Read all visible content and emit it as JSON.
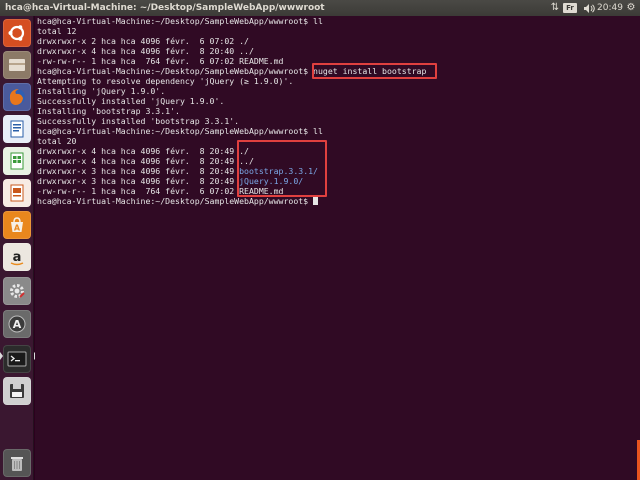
{
  "top_panel": {
    "window_title": "hca@hca-Virtual-Machine: ~/Desktop/SampleWebApp/wwwroot",
    "keyboard_layout": "Fr",
    "clock": "20:49"
  },
  "launcher": {
    "items": [
      {
        "id": "dash",
        "icon": "ubuntu-logo-icon",
        "bg": "#d54e21"
      },
      {
        "id": "files",
        "icon": "files-icon",
        "bg": "#8c7a67"
      },
      {
        "id": "firefox",
        "icon": "firefox-icon",
        "bg": "#4a5a9c"
      },
      {
        "id": "writer",
        "icon": "libreoffice-writer-icon",
        "bg": "#e8eef7"
      },
      {
        "id": "calc",
        "icon": "libreoffice-calc-icon",
        "bg": "#e8f2e3"
      },
      {
        "id": "impress",
        "icon": "libreoffice-impress-icon",
        "bg": "#f7ebe3"
      },
      {
        "id": "software-center",
        "icon": "software-center-icon",
        "bg": "#e9871d"
      },
      {
        "id": "amazon",
        "icon": "amazon-icon",
        "bg": "#ece7e0"
      },
      {
        "id": "settings",
        "icon": "system-settings-icon",
        "bg": "#8a8a8a"
      },
      {
        "id": "updater",
        "icon": "software-updater-icon",
        "bg": "#6a6a6a"
      },
      {
        "id": "terminal",
        "icon": "terminal-icon",
        "bg": "#2b2b2b"
      },
      {
        "id": "disk",
        "icon": "disk-icon",
        "bg": "#d0d0d0"
      },
      {
        "id": "trash",
        "icon": "trash-icon",
        "bg": "#555555"
      }
    ]
  },
  "terminal": {
    "lines": [
      "hca@hca-Virtual-Machine:~/Desktop/SampleWebApp/wwwroot$ ll",
      "total 12",
      "drwxrwxr-x 2 hca hca 4096 févr.  6 07:02 ./",
      "drwxrwxr-x 4 hca hca 4096 févr.  8 20:40 ../",
      "-rw-rw-r-- 1 hca hca  764 févr.  6 07:02 README.md",
      "hca@hca-Virtual-Machine:~/Desktop/SampleWebApp/wwwroot$ nuget install bootstrap",
      "Attempting to resolve dependency 'jQuery (≥ 1.9.0)'.",
      "Installing 'jQuery 1.9.0'.",
      "Successfully installed 'jQuery 1.9.0'.",
      "Installing 'bootstrap 3.3.1'.",
      "Successfully installed 'bootstrap 3.3.1'.",
      "hca@hca-Virtual-Machine:~/Desktop/SampleWebApp/wwwroot$ ll",
      "total 20",
      {
        "prefix": "drwxrwxr-x 4 hca hca 4096 févr.  8 20:49 ",
        "name": "./"
      },
      {
        "prefix": "drwxrwxr-x 4 hca hca 4096 févr.  8 20:49 ",
        "name": "../"
      },
      {
        "prefix": "drwxrwxr-x 3 hca hca 4096 févr.  8 20:49 ",
        "name": "bootstrap.3.3.1/",
        "color": "blue"
      },
      {
        "prefix": "drwxrwxr-x 3 hca hca 4096 févr.  8 20:49 ",
        "name": "jQuery.1.9.0/",
        "color": "blue"
      },
      {
        "prefix": "-rw-rw-r-- 1 hca hca  764 févr.  6 07:02 ",
        "name": "README.md"
      },
      "hca@hca-Virtual-Machine:~/Desktop/SampleWebApp/wwwroot$ "
    ]
  },
  "colors": {
    "terminal_bg": "#300a24",
    "highlight": "#e0403f",
    "directory": "#7ba7e6"
  }
}
